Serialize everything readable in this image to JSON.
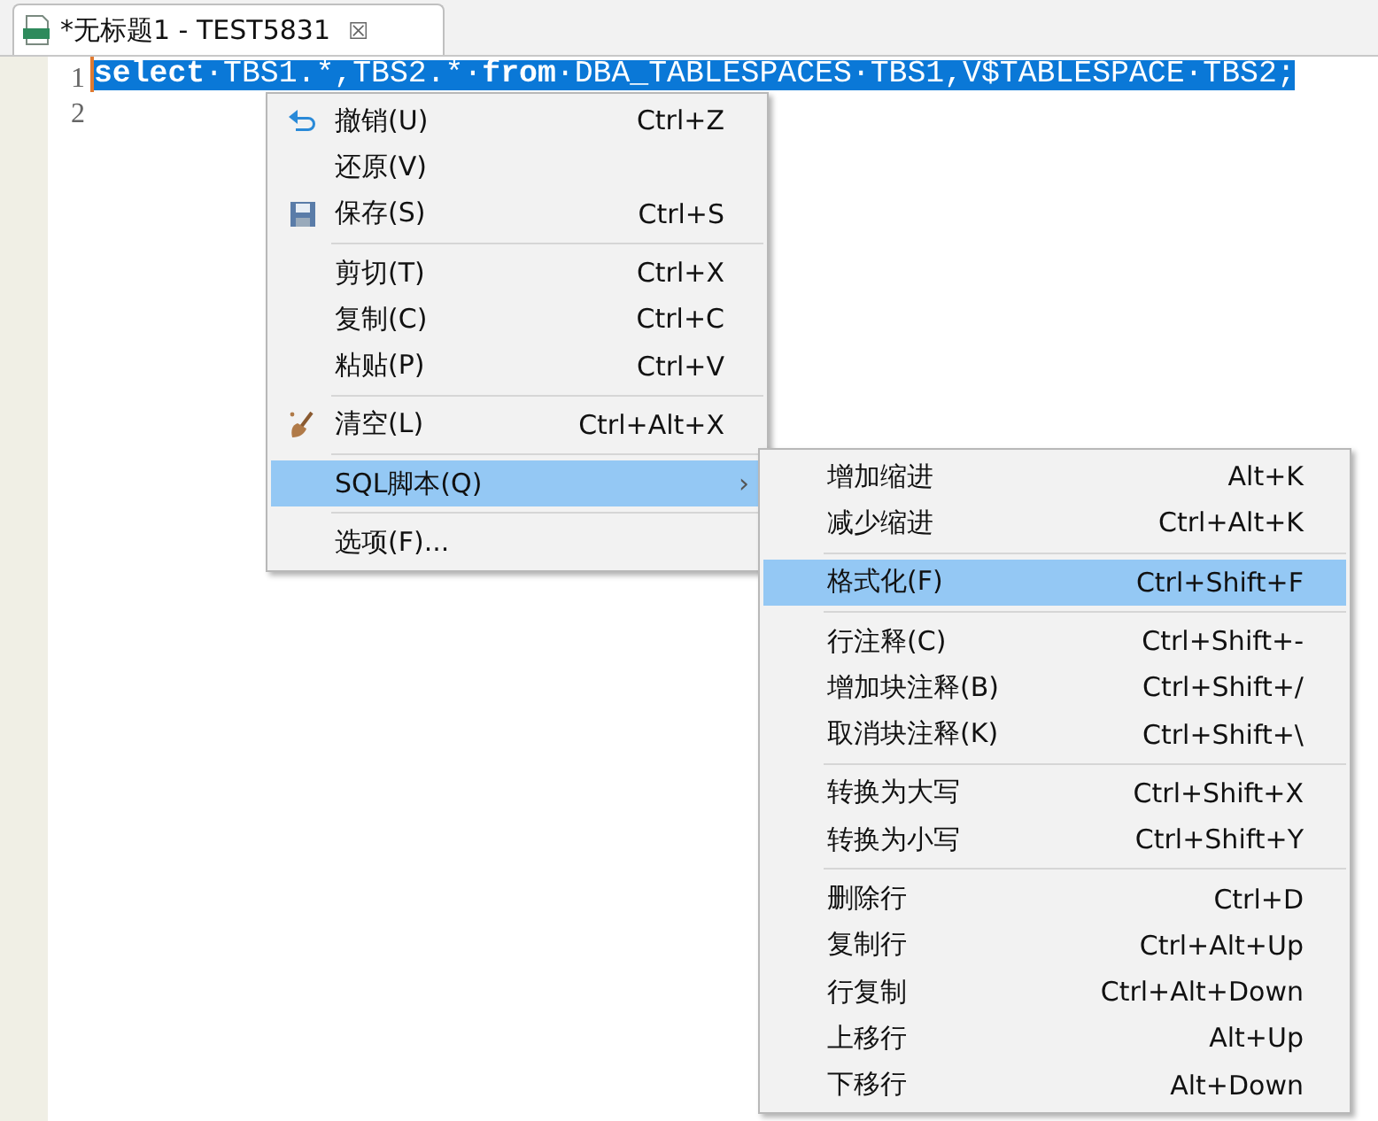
{
  "tab": {
    "title": "*无标题1 - TEST5831",
    "close": "☒",
    "selected": true
  },
  "editor": {
    "lines": [
      {
        "number": "1",
        "selected": true,
        "tokens": [
          {
            "kind": "keyword",
            "text": "select"
          },
          {
            "kind": "plain",
            "text": "·TBS1.*,TBS2.*·"
          },
          {
            "kind": "keyword",
            "text": "from"
          },
          {
            "kind": "plain",
            "text": "·DBA_TABLESPACES·TBS1,V$TABLESPACE·TBS2;"
          }
        ]
      },
      {
        "number": "2"
      }
    ]
  },
  "context_menu": {
    "groups": [
      [
        {
          "label": "撤销(U)",
          "shortcut": "Ctrl+Z",
          "selected": false
        },
        {
          "label": "还原(V)",
          "selected": false
        },
        {
          "label": "保存(S)",
          "shortcut": "Ctrl+S",
          "selected": false
        }
      ],
      [
        {
          "label": "剪切(T)",
          "shortcut": "Ctrl+X",
          "selected": false
        },
        {
          "label": "复制(C)",
          "shortcut": "Ctrl+C",
          "selected": false
        },
        {
          "label": "粘贴(P)",
          "shortcut": "Ctrl+V",
          "selected": false
        }
      ],
      [
        {
          "label": "清空(L)",
          "shortcut": "Ctrl+Alt+X",
          "selected": false
        }
      ],
      [
        {
          "label": "SQL脚本(Q)",
          "selected": true,
          "arrow": "›"
        }
      ],
      [
        {
          "label": "选项(F)...",
          "selected": false
        }
      ]
    ]
  },
  "submenu": {
    "groups": [
      [
        {
          "label": "增加缩进",
          "shortcut": "Alt+K",
          "selected": false
        },
        {
          "label": "减少缩进",
          "shortcut": "Ctrl+Alt+K",
          "selected": false
        }
      ],
      [
        {
          "label": "格式化(F)",
          "shortcut": "Ctrl+Shift+F",
          "selected": true
        }
      ],
      [
        {
          "label": "行注释(C)",
          "shortcut": "Ctrl+Shift+-",
          "selected": false
        },
        {
          "label": "增加块注释(B)",
          "shortcut": "Ctrl+Shift+/",
          "selected": false
        },
        {
          "label": "取消块注释(K)",
          "shortcut": "Ctrl+Shift+\\",
          "selected": false
        }
      ],
      [
        {
          "label": "转换为大写",
          "shortcut": "Ctrl+Shift+X",
          "selected": false
        },
        {
          "label": "转换为小写",
          "shortcut": "Ctrl+Shift+Y",
          "selected": false
        }
      ],
      [
        {
          "label": "删除行",
          "shortcut": "Ctrl+D",
          "selected": false
        },
        {
          "label": "复制行",
          "shortcut": "Ctrl+Alt+Up",
          "selected": false
        },
        {
          "label": "行复制",
          "shortcut": "Ctrl+Alt+Down",
          "selected": false
        },
        {
          "label": "上移行",
          "shortcut": "Alt+Up",
          "selected": false
        },
        {
          "label": "下移行",
          "shortcut": "Alt+Down",
          "selected": false
        }
      ]
    ]
  }
}
